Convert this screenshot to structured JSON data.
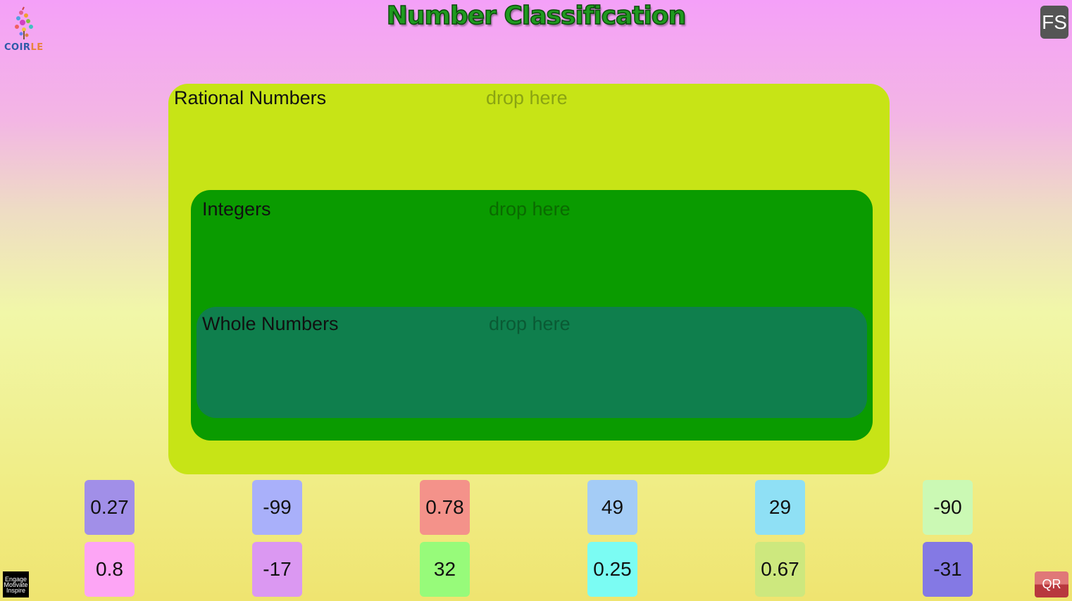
{
  "app": {
    "title": "Number Classification",
    "logo_text_a": "COIR",
    "logo_text_b": "LE",
    "fs_label": "FS",
    "qr_label": "QR",
    "badge_lines": [
      "Engage",
      "Motivate",
      "Inspire"
    ]
  },
  "zones": {
    "rational": {
      "label": "Rational Numbers",
      "drop": "drop here",
      "color": "#c7e416"
    },
    "integers": {
      "label": "Integers",
      "drop": "drop here",
      "color": "#0a9b00"
    },
    "whole": {
      "label": "Whole Numbers",
      "drop": "drop here",
      "color": "#0f7f4d"
    }
  },
  "tiles": [
    {
      "value": "0.27",
      "color": "#a18fe8"
    },
    {
      "value": "-99",
      "color": "#a9b0fa"
    },
    {
      "value": "0.78",
      "color": "#f4928a"
    },
    {
      "value": "49",
      "color": "#a4ccf6"
    },
    {
      "value": "29",
      "color": "#8fe0f5"
    },
    {
      "value": "-90",
      "color": "#cbf9b4"
    },
    {
      "value": "0.8",
      "color": "#fda5f5"
    },
    {
      "value": "-17",
      "color": "#db98f2"
    },
    {
      "value": "32",
      "color": "#97fb7a"
    },
    {
      "value": "0.25",
      "color": "#7bfcf3"
    },
    {
      "value": "0.67",
      "color": "#cde87e"
    },
    {
      "value": "-31",
      "color": "#8479e4"
    }
  ]
}
